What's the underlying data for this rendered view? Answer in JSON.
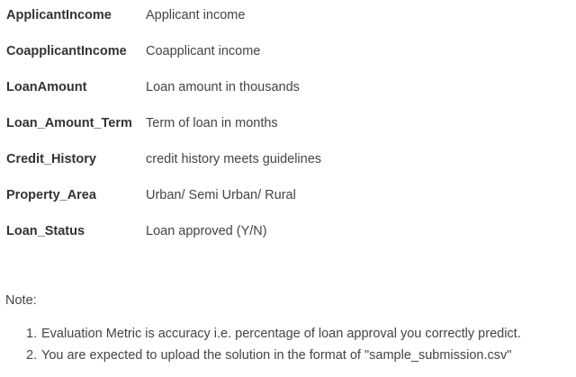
{
  "variables": [
    {
      "name": "ApplicantIncome",
      "description": "Applicant income"
    },
    {
      "name": "CoapplicantIncome",
      "description": "Coapplicant income"
    },
    {
      "name": "LoanAmount",
      "description": "Loan amount in thousands"
    },
    {
      "name": "Loan_Amount_Term",
      "description": "Term of loan in months"
    },
    {
      "name": "Credit_History",
      "description": "credit history meets guidelines"
    },
    {
      "name": "Property_Area",
      "description": "Urban/ Semi Urban/ Rural"
    },
    {
      "name": "Loan_Status",
      "description": "Loan approved (Y/N)"
    }
  ],
  "note": {
    "label": "Note:",
    "items": [
      {
        "number": "1.",
        "text": "Evaluation Metric is accuracy i.e. percentage of loan approval you correctly predict."
      },
      {
        "number": "2.",
        "text": "You are expected to upload the solution in the format of \"sample_submission.csv\""
      }
    ]
  }
}
